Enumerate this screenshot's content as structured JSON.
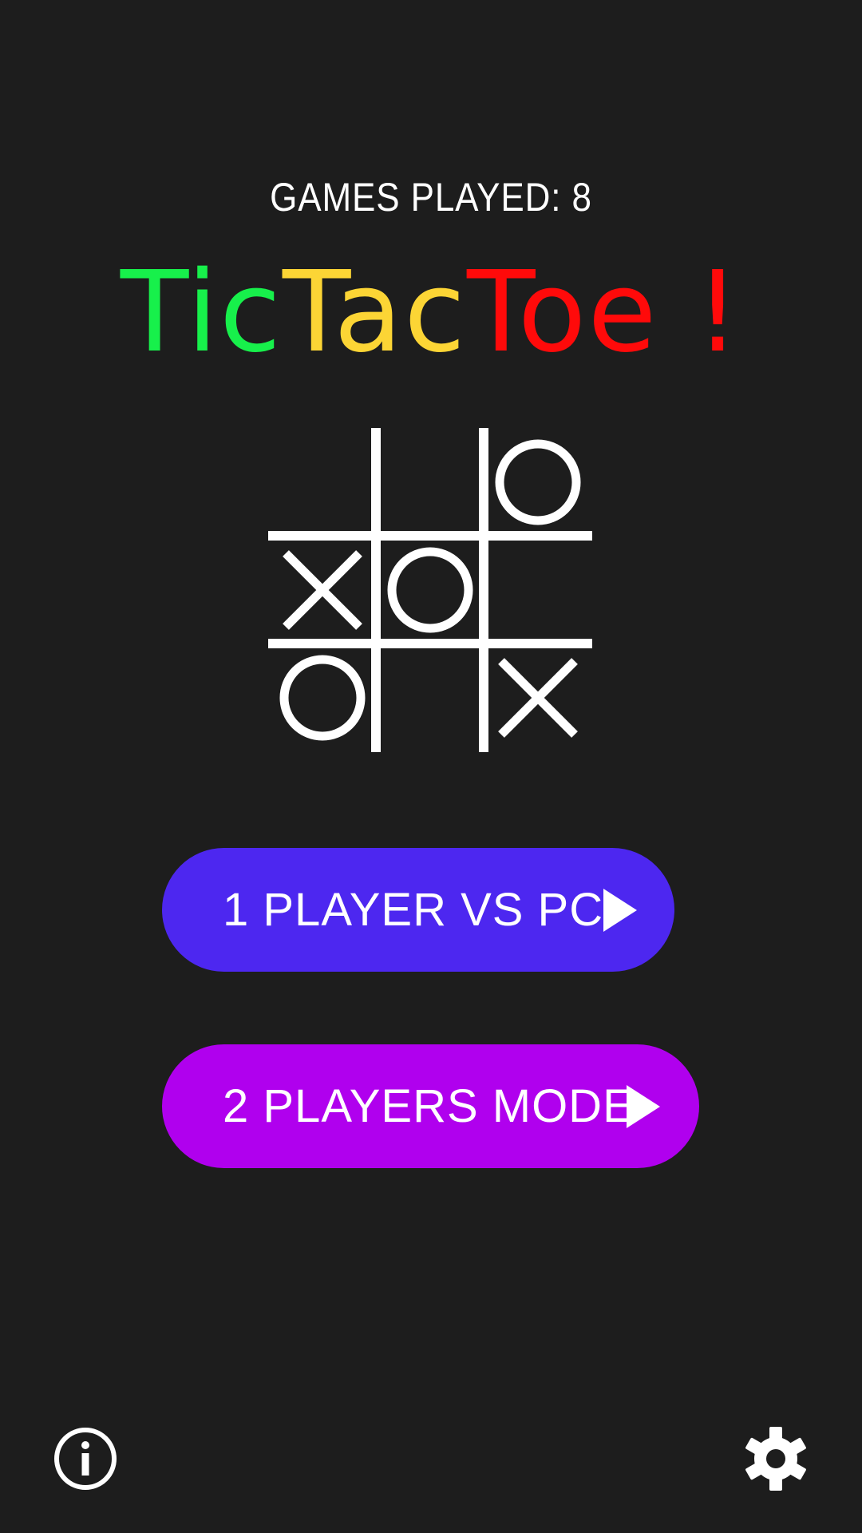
{
  "stats": {
    "games_played_label": "GAMES PLAYED: 8"
  },
  "title": {
    "parts": [
      {
        "text": "Tic",
        "color": "#17f04b"
      },
      {
        "text": "Tac",
        "color": "#fcd535"
      },
      {
        "text": "Toe !",
        "color": "#ff0a0a"
      }
    ]
  },
  "board": {
    "cells": [
      "",
      "",
      "O",
      "X",
      "O",
      "",
      "O",
      "",
      "X"
    ]
  },
  "buttons": {
    "one_player_label": "1 PLAYER VS PC",
    "one_player_color": "#4d27f0",
    "two_players_label": "2 PLAYERS MODE",
    "two_players_color": "#b000ee"
  },
  "footer": {
    "left_icon": "info-icon",
    "right_icon": "gear-icon"
  }
}
